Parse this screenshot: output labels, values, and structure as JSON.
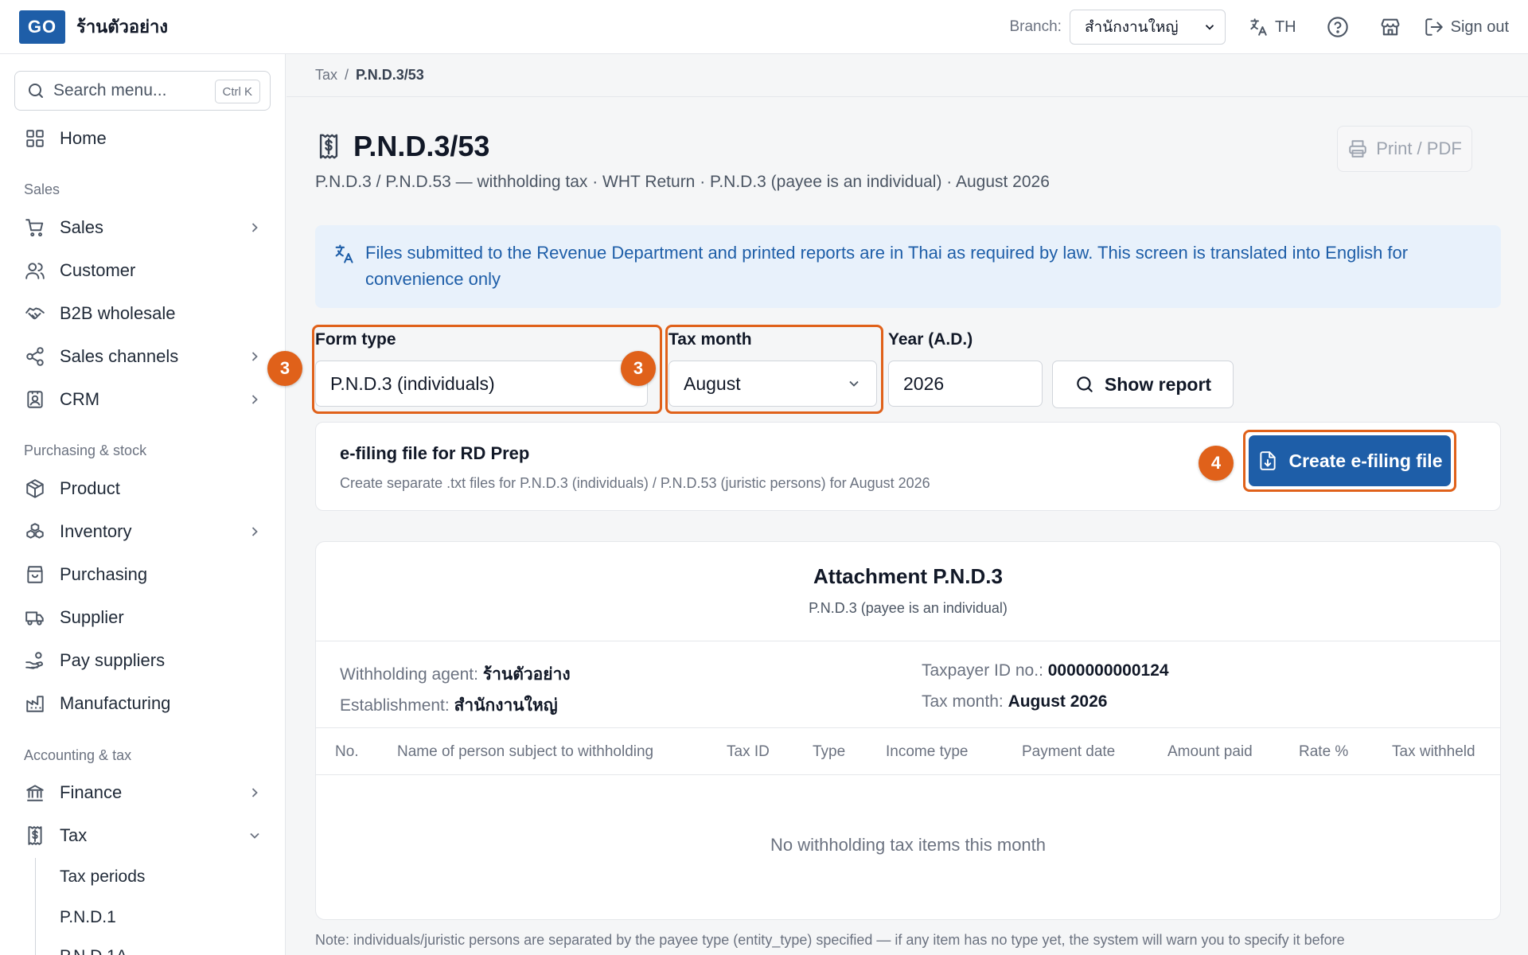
{
  "header": {
    "logo_text": "GO",
    "shop_name": "ร้านตัวอย่าง",
    "branch_label": "Branch:",
    "branch_value": "สำนักงานใหญ่",
    "language_label": "TH",
    "sign_out_label": "Sign out"
  },
  "sidebar": {
    "search_placeholder": "Search menu...",
    "search_shortcut": "Ctrl K",
    "home": "Home",
    "section_sales": "Sales",
    "sales": "Sales",
    "customer": "Customer",
    "b2b": "B2B wholesale",
    "sales_channels": "Sales channels",
    "crm": "CRM",
    "section_purchasing": "Purchasing & stock",
    "product": "Product",
    "inventory": "Inventory",
    "purchasing": "Purchasing",
    "supplier": "Supplier",
    "pay_suppliers": "Pay suppliers",
    "manufacturing": "Manufacturing",
    "section_accounting": "Accounting & tax",
    "finance": "Finance",
    "tax": "Tax",
    "tax_periods": "Tax periods",
    "pnd1": "P.N.D.1",
    "pnd1a": "P.N.D.1A"
  },
  "breadcrumb": {
    "parent": "Tax",
    "separator": "/",
    "current": "P.N.D.3/53"
  },
  "page": {
    "title": "P.N.D.3/53",
    "subtitle": "P.N.D.3 / P.N.D.53 — withholding tax · WHT Return · P.N.D.3 (payee is an individual) · August 2026",
    "print_label": "Print / PDF",
    "info_text": "Files submitted to the Revenue Department and printed reports are in Thai as required by law. This screen is translated into English for convenience only"
  },
  "filters": {
    "form_type_label": "Form type",
    "form_type_value": "P.N.D.3 (individuals)",
    "tax_month_label": "Tax month",
    "tax_month_value": "August",
    "year_label": "Year (A.D.)",
    "year_value": "2026",
    "show_report_label": "Show report"
  },
  "badges": {
    "form_type": "3",
    "tax_month": "3",
    "create": "4"
  },
  "efiling": {
    "title": "e-filing file for RD Prep",
    "description": "Create separate .txt files for P.N.D.3 (individuals) / P.N.D.53 (juristic persons) for August 2026",
    "button_label": "Create e-filing file"
  },
  "report": {
    "title": "Attachment P.N.D.3",
    "subtitle": "P.N.D.3 (payee is an individual)",
    "agent_label": "Withholding agent:",
    "agent_value": "ร้านตัวอย่าง",
    "establishment_label": "Establishment:",
    "establishment_value": "สำนักงานใหญ่",
    "taxpayer_id_label": "Taxpayer ID no.:",
    "taxpayer_id_value": "0000000000124",
    "tax_month_label": "Tax month:",
    "tax_month_value": "August 2026",
    "columns": [
      "No.",
      "Name of person subject to withholding",
      "Tax ID",
      "Type",
      "Income type",
      "Payment date",
      "Amount paid",
      "Rate %",
      "Tax withheld"
    ],
    "empty_message": "No withholding tax items this month"
  },
  "note": "Note: individuals/juristic persons are separated by the payee type (entity_type) specified — if any item has no type yet, the system will warn you to specify it before",
  "colors": {
    "brand": "#1e5ea8",
    "highlight": "#e0611a",
    "info_bg": "#e8f1fb"
  }
}
